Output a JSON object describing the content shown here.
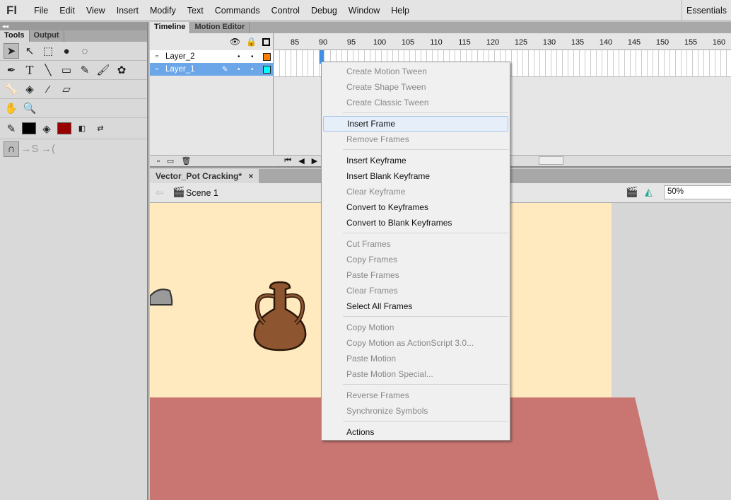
{
  "app": {
    "logo": "Fl",
    "workspace": "Essentials"
  },
  "menubar": [
    "File",
    "Edit",
    "View",
    "Insert",
    "Modify",
    "Text",
    "Commands",
    "Control",
    "Debug",
    "Window",
    "Help"
  ],
  "left_panel": {
    "collapse": "◂◂",
    "tabs": [
      "Tools",
      "Output"
    ],
    "stroke_color": "#000000",
    "fill_color": "#990000"
  },
  "timeline": {
    "tabs": [
      "Timeline",
      "Motion Editor"
    ],
    "layers": [
      {
        "name": "Layer_2",
        "color": "#ff8000",
        "selected": false
      },
      {
        "name": "Layer_1",
        "color": "#00ffff",
        "selected": true
      }
    ],
    "ruler": [
      85,
      90,
      95,
      100,
      105,
      110,
      115,
      120,
      125,
      130,
      135,
      140,
      145,
      150,
      155,
      160
    ],
    "current_frame": 90
  },
  "document": {
    "tab": "Vector_Pot Cracking*",
    "close": "×",
    "scene": "Scene 1",
    "zoom": "50%"
  },
  "colors": {
    "stage": "#ffe9bf",
    "floor": "#c97672",
    "pot": "#8e5630"
  },
  "context_menu": [
    [
      {
        "label": "Create Motion Tween",
        "enabled": false
      },
      {
        "label": "Create Shape Tween",
        "enabled": false
      },
      {
        "label": "Create Classic Tween",
        "enabled": false
      }
    ],
    [
      {
        "label": "Insert Frame",
        "enabled": true,
        "highlighted": true
      },
      {
        "label": "Remove Frames",
        "enabled": false
      }
    ],
    [
      {
        "label": "Insert Keyframe",
        "enabled": true
      },
      {
        "label": "Insert Blank Keyframe",
        "enabled": true
      },
      {
        "label": "Clear Keyframe",
        "enabled": false
      },
      {
        "label": "Convert to Keyframes",
        "enabled": true
      },
      {
        "label": "Convert to Blank Keyframes",
        "enabled": true
      }
    ],
    [
      {
        "label": "Cut Frames",
        "enabled": false
      },
      {
        "label": "Copy Frames",
        "enabled": false
      },
      {
        "label": "Paste Frames",
        "enabled": false
      },
      {
        "label": "Clear Frames",
        "enabled": false
      },
      {
        "label": "Select All Frames",
        "enabled": true
      }
    ],
    [
      {
        "label": "Copy Motion",
        "enabled": false
      },
      {
        "label": "Copy Motion as ActionScript 3.0...",
        "enabled": false
      },
      {
        "label": "Paste Motion",
        "enabled": false
      },
      {
        "label": "Paste Motion Special...",
        "enabled": false
      }
    ],
    [
      {
        "label": "Reverse Frames",
        "enabled": false
      },
      {
        "label": "Synchronize Symbols",
        "enabled": false
      }
    ],
    [
      {
        "label": "Actions",
        "enabled": true
      }
    ]
  ]
}
